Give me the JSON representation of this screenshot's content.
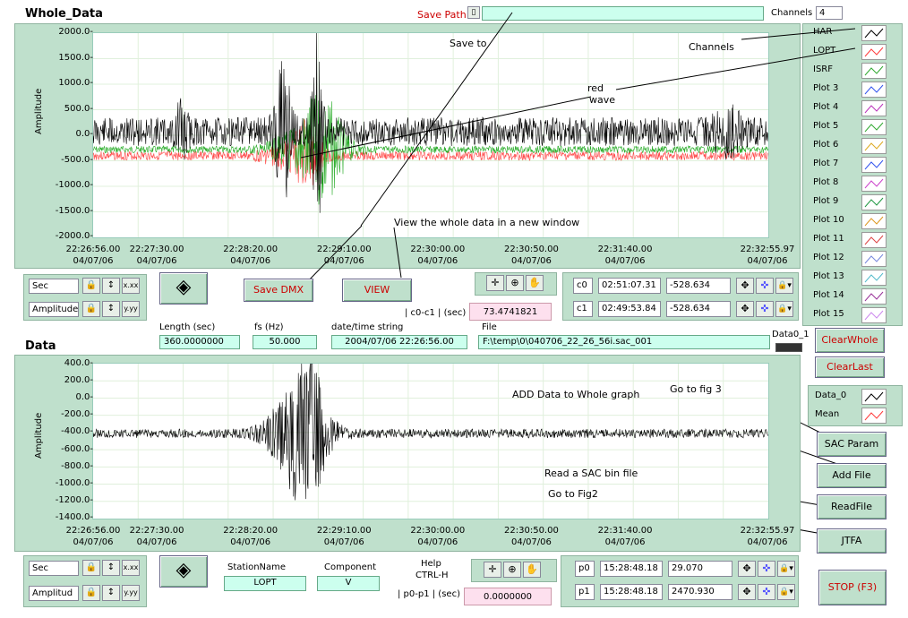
{
  "whole": {
    "title": "Whole_Data",
    "ylabel": "Amplitude",
    "yticks": [
      "2000.0-",
      "1500.0-",
      "1000.0-",
      "500.0-",
      "0.0-",
      "-500.0-",
      "-1000.0-",
      "-1500.0-",
      "-2000.0-"
    ],
    "xticks": [
      {
        "t": "22:26:56.00",
        "d": "04/07/06"
      },
      {
        "t": "22:27:30.00",
        "d": "04/07/06"
      },
      {
        "t": "22:28:20.00",
        "d": "04/07/06"
      },
      {
        "t": "22:29:10.00",
        "d": "04/07/06"
      },
      {
        "t": "22:30:00.00",
        "d": "04/07/06"
      },
      {
        "t": "22:30:50.00",
        "d": "04/07/06"
      },
      {
        "t": "22:31:40.00",
        "d": "04/07/06"
      },
      {
        "t": "22:32:55.97",
        "d": "04/07/06"
      }
    ]
  },
  "save_path": {
    "label": "Save Path",
    "value": ""
  },
  "channels": {
    "label": "Channels",
    "value": "4"
  },
  "legend1": [
    {
      "name": "HAR",
      "color": "#000000"
    },
    {
      "name": "LOPT",
      "color": "#ff3b3b"
    },
    {
      "name": "ISRF",
      "color": "#33aa33"
    },
    {
      "name": "Plot 3",
      "color": "#3355ee"
    },
    {
      "name": "Plot 4",
      "color": "#bb33bb"
    },
    {
      "name": "Plot 5",
      "color": "#33aa33"
    },
    {
      "name": "Plot 6",
      "color": "#ddaa22"
    },
    {
      "name": "Plot 7",
      "color": "#3355ee"
    },
    {
      "name": "Plot 8",
      "color": "#cc44cc"
    },
    {
      "name": "Plot 9",
      "color": "#229944"
    },
    {
      "name": "Plot 10",
      "color": "#dd9922"
    },
    {
      "name": "Plot 11",
      "color": "#dd4444"
    },
    {
      "name": "Plot 12",
      "color": "#7788dd"
    },
    {
      "name": "Plot 13",
      "color": "#55bbcc"
    },
    {
      "name": "Plot 14",
      "color": "#993399"
    },
    {
      "name": "Plot 15",
      "color": "#cc88ee"
    }
  ],
  "annotations": {
    "save_to": "Save to",
    "channels": "Channels",
    "red_wave1": "red",
    "red_wave2": "wave",
    "view_whole": "View the whole data in a new window",
    "add_data": "ADD Data to Whole graph",
    "go_fig3": "Go to fig 3",
    "read_sac": "Read a SAC bin file",
    "go_fig2": "Go to Fig2"
  },
  "scale1": {
    "x_unit": "Sec",
    "y_unit": "Amplitude",
    "xfmt": "x.xx",
    "yfmt": "y.yy"
  },
  "buttons": {
    "save_dmx": "Save DMX",
    "view": "VIEW",
    "clear_whole": "ClearWhole",
    "clear_last": "ClearLast",
    "sac_param": "SAC Param",
    "add_file": "Add File",
    "read_file": "ReadFile",
    "jtfa": "JTFA",
    "stop": "STOP (F3)"
  },
  "c0c1": {
    "label": "| c0-c1 | (sec)",
    "value": "73.4741821"
  },
  "cursors1": [
    {
      "name": "c0",
      "time": "02:51:07.31",
      "value": "-528.634"
    },
    {
      "name": "c1",
      "time": "02:49:53.84",
      "value": "-528.634"
    }
  ],
  "info": {
    "length_label": "Length (sec)",
    "length": "360.0000000",
    "fs_label": "fs (Hz)",
    "fs": "50.000",
    "dt_label": "date/time string",
    "dt": "2004/07/06 22:26:56.00",
    "file_label": "File",
    "file": "F:\\temp\\0\\040706_22_26_56i.sac_001",
    "data0_label": "Data0_1"
  },
  "data": {
    "title": "Data",
    "ylabel": "Amplitude",
    "yticks": [
      "400.0-",
      "200.0-",
      "0.0-",
      "-200.0-",
      "-400.0-",
      "-600.0-",
      "-800.0-",
      "-1000.0-",
      "-1200.0-",
      "-1400.0-"
    ],
    "xticks": [
      {
        "t": "22:26:56.00",
        "d": "04/07/06"
      },
      {
        "t": "22:27:30.00",
        "d": "04/07/06"
      },
      {
        "t": "22:28:20.00",
        "d": "04/07/06"
      },
      {
        "t": "22:29:10.00",
        "d": "04/07/06"
      },
      {
        "t": "22:30:00.00",
        "d": "04/07/06"
      },
      {
        "t": "22:30:50.00",
        "d": "04/07/06"
      },
      {
        "t": "22:31:40.00",
        "d": "04/07/06"
      },
      {
        "t": "22:32:55.97",
        "d": "04/07/06"
      }
    ]
  },
  "legend2": [
    {
      "name": "Data_0",
      "color": "#000000"
    },
    {
      "name": "Mean",
      "color": "#ff3b3b"
    }
  ],
  "scale2": {
    "x_unit": "Sec",
    "y_unit": "Amplitud",
    "xfmt": "x.xx",
    "yfmt": "y.yy"
  },
  "station": {
    "label": "StationName",
    "value": "LOPT"
  },
  "component": {
    "label": "Component",
    "value": "V"
  },
  "help": {
    "line1": "Help",
    "line2": "CTRL-H"
  },
  "p0p1": {
    "label": "| p0-p1 | (sec)",
    "value": "0.0000000"
  },
  "cursors2": [
    {
      "name": "p0",
      "time": "15:28:48.18",
      "value": "29.070"
    },
    {
      "name": "p1",
      "time": "15:28:48.18",
      "value": "2470.930"
    }
  ]
}
